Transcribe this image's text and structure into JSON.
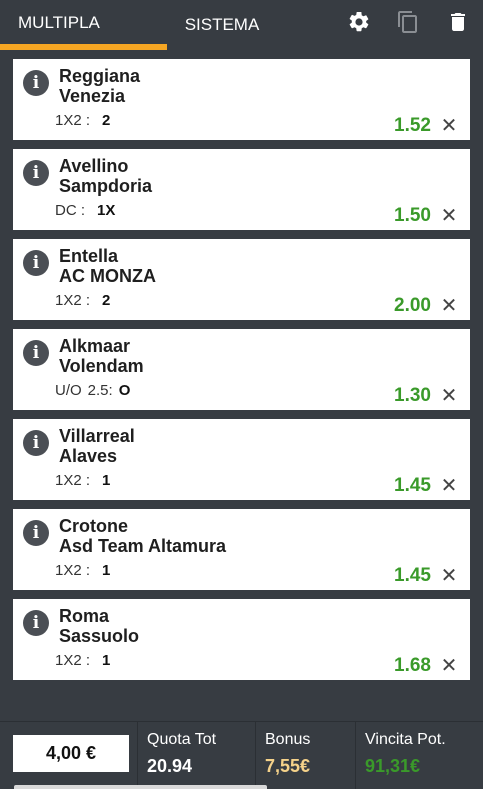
{
  "tabs": {
    "multipla": "MULTIPLA",
    "sistema": "SISTEMA"
  },
  "header_icons": [
    "gear-icon",
    "copy-icon",
    "trash-icon"
  ],
  "colors": {
    "accent": "#f5a623",
    "odds": "#3a9a2a",
    "bonus": "#f5d28a",
    "win": "#3a9a2a"
  },
  "bets": [
    {
      "team1": "Reggiana",
      "team2": "Venezia",
      "market_label": "1X2 :",
      "market_extra": "",
      "pick": "2",
      "odd": "1.52",
      "remove": "✕"
    },
    {
      "team1": "Avellino",
      "team2": "Sampdoria",
      "market_label": "DC :",
      "market_extra": "",
      "pick": "1X",
      "odd": "1.50",
      "remove": "✕"
    },
    {
      "team1": "Entella",
      "team2": "AC MONZA",
      "market_label": "1X2 :",
      "market_extra": "",
      "pick": "2",
      "odd": "2.00",
      "remove": "✕"
    },
    {
      "team1": "Alkmaar",
      "team2": "Volendam",
      "market_label": "U/O",
      "market_extra": "2.5:",
      "pick": "O",
      "odd": "1.30",
      "remove": "✕"
    },
    {
      "team1": "Villarreal",
      "team2": "Alaves",
      "market_label": "1X2 :",
      "market_extra": "",
      "pick": "1",
      "odd": "1.45",
      "remove": "✕"
    },
    {
      "team1": "Crotone",
      "team2": "Asd Team Altamura",
      "market_label": "1X2 :",
      "market_extra": "",
      "pick": "1",
      "odd": "1.45",
      "remove": "✕"
    },
    {
      "team1": "Roma",
      "team2": "Sassuolo",
      "market_label": "1X2 :",
      "market_extra": "",
      "pick": "1",
      "odd": "1.68",
      "remove": "✕"
    }
  ],
  "footer": {
    "stake": "4,00 €",
    "quota_label": "Quota Tot",
    "quota_value": "20.94",
    "bonus_label": "Bonus",
    "bonus_value": "7,55€",
    "vincita_label": "Vincita Pot.",
    "vincita_value": "91,31€"
  }
}
